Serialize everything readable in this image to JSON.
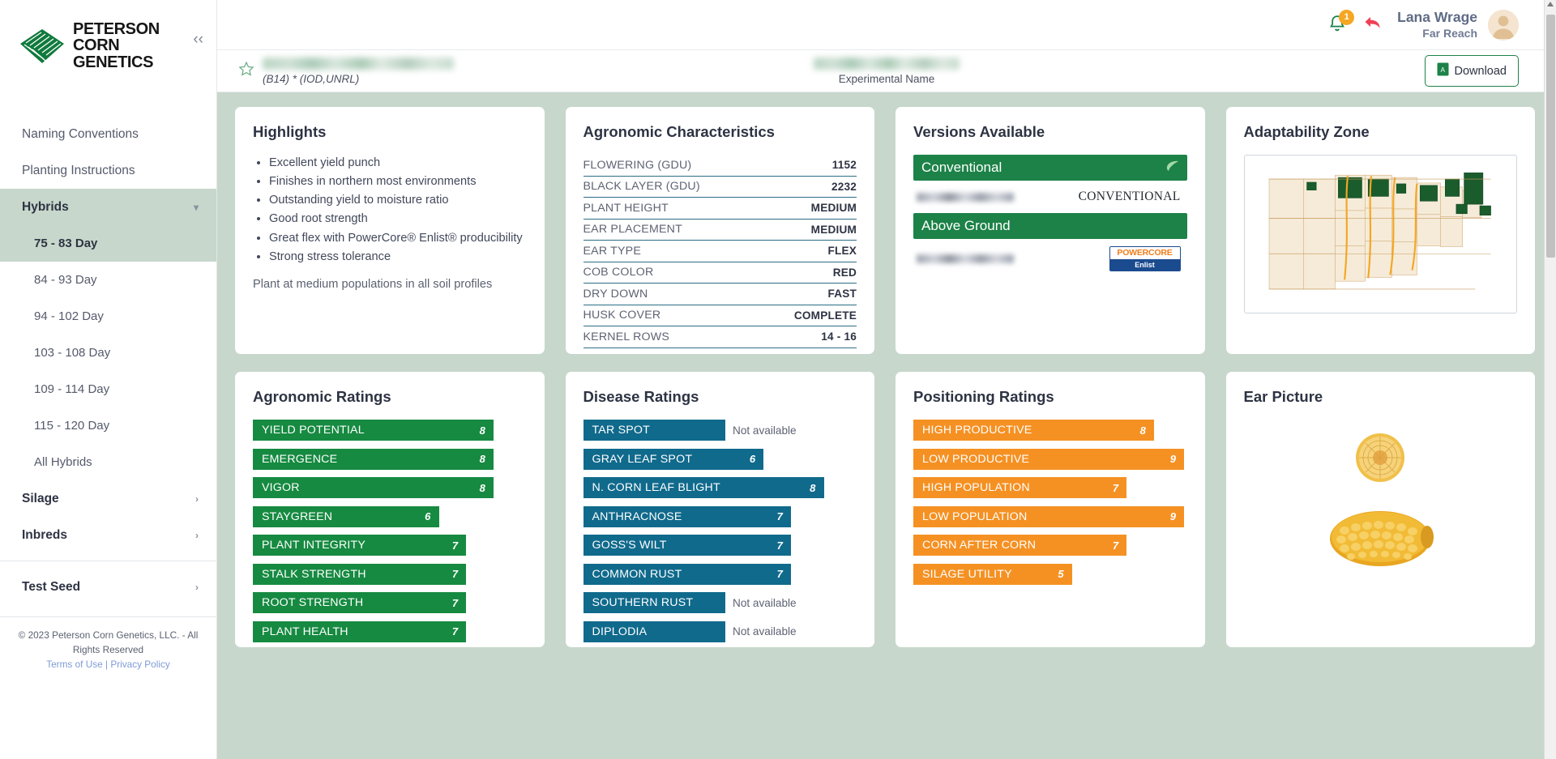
{
  "brand": {
    "line1": "PETERSON",
    "line2": "CORN GENETICS",
    "collapse_icon": "chevron-left"
  },
  "sidebar": {
    "items": [
      {
        "label": "Naming Conventions",
        "type": "link"
      },
      {
        "label": "Planting Instructions",
        "type": "link"
      },
      {
        "label": "Hybrids",
        "type": "group",
        "active": true,
        "chevron": "⌄"
      },
      {
        "label": "75 - 83 Day",
        "type": "sub",
        "active": true
      },
      {
        "label": "84 - 93 Day",
        "type": "sub"
      },
      {
        "label": "94 - 102 Day",
        "type": "sub"
      },
      {
        "label": "103 - 108 Day",
        "type": "sub"
      },
      {
        "label": "109 - 114 Day",
        "type": "sub"
      },
      {
        "label": "115 - 120 Day",
        "type": "sub"
      },
      {
        "label": "All Hybrids",
        "type": "sub"
      },
      {
        "label": "Silage",
        "type": "group",
        "chevron": "›"
      },
      {
        "label": "Inbreds",
        "type": "group",
        "chevron": "›"
      },
      {
        "label": "Test Seed",
        "type": "group",
        "chevron": "›"
      }
    ],
    "footer": {
      "copyright": "© 2023 Peterson Corn Genetics, LLC. - All Rights Reserved",
      "terms": "Terms of Use",
      "separator": "|",
      "privacy": "Privacy Policy"
    }
  },
  "topbar": {
    "notification_count": "1",
    "bell_icon": "bell-icon",
    "reply_icon": "reply-arrow-icon",
    "user_name": "Lana Wrage",
    "user_org": "Far Reach",
    "avatar": "user-avatar"
  },
  "titlebar": {
    "star_icon": "star-outline-icon",
    "product_name_redacted": true,
    "product_code": "(B14) * (IOD,UNRL)",
    "experimental_name_redacted": true,
    "experimental_label": "Experimental Name",
    "download_label": "Download",
    "download_icon": "pdf-file-icon"
  },
  "highlights": {
    "title": "Highlights",
    "bullets": [
      "Excellent yield punch",
      "Finishes in northern most environments",
      "Outstanding yield to moisture ratio",
      "Good root strength",
      "Great flex with PowerCore® Enlist® producibility",
      "Strong stress tolerance"
    ],
    "note": "Plant at medium populations in all soil profiles"
  },
  "agronomic_characteristics": {
    "title": "Agronomic Characteristics",
    "rows": [
      {
        "key": "FLOWERING (GDU)",
        "value": "1152"
      },
      {
        "key": "BLACK LAYER (GDU)",
        "value": "2232"
      },
      {
        "key": "PLANT HEIGHT",
        "value": "MEDIUM"
      },
      {
        "key": "EAR PLACEMENT",
        "value": "MEDIUM"
      },
      {
        "key": "EAR TYPE",
        "value": "FLEX"
      },
      {
        "key": "COB COLOR",
        "value": "RED"
      },
      {
        "key": "DRY DOWN",
        "value": "FAST"
      },
      {
        "key": "HUSK COVER",
        "value": "COMPLETE"
      },
      {
        "key": "KERNEL ROWS",
        "value": "14 - 16"
      }
    ]
  },
  "versions_available": {
    "title": "Versions Available",
    "groups": [
      {
        "header": "Conventional",
        "header_icon": "leaf-icon",
        "rows": [
          {
            "name_redacted": true,
            "trait_label": "CONVENTIONAL",
            "badge": "text"
          }
        ]
      },
      {
        "header": "Above Ground",
        "header_icon": "",
        "rows": [
          {
            "name_redacted": true,
            "trait_label": "",
            "badge": "powercore-enlist-logo",
            "logo_top": "POWERCORE",
            "logo_bottom": "Enlist"
          }
        ]
      }
    ]
  },
  "adaptability_zone": {
    "title": "Adaptability Zone",
    "map_icon": "us-midwest-map"
  },
  "agronomic_ratings": {
    "title": "Agronomic Ratings",
    "color": "#168a41",
    "items": [
      {
        "label": "YIELD POTENTIAL",
        "value": "8"
      },
      {
        "label": "EMERGENCE",
        "value": "8"
      },
      {
        "label": "VIGOR",
        "value": "8"
      },
      {
        "label": "STAYGREEN",
        "value": "6"
      },
      {
        "label": "PLANT INTEGRITY",
        "value": "7"
      },
      {
        "label": "STALK STRENGTH",
        "value": "7"
      },
      {
        "label": "ROOT STRENGTH",
        "value": "7"
      },
      {
        "label": "PLANT HEALTH",
        "value": "7"
      }
    ]
  },
  "disease_ratings": {
    "title": "Disease Ratings",
    "color": "#106a8c",
    "not_available_text": "Not available",
    "items": [
      {
        "label": "TAR SPOT",
        "value": null
      },
      {
        "label": "GRAY LEAF SPOT",
        "value": "6"
      },
      {
        "label": "N. CORN LEAF BLIGHT",
        "value": "8"
      },
      {
        "label": "ANTHRACNOSE",
        "value": "7"
      },
      {
        "label": "GOSS'S WILT",
        "value": "7"
      },
      {
        "label": "COMMON RUST",
        "value": "7"
      },
      {
        "label": "SOUTHERN RUST",
        "value": null
      },
      {
        "label": "DIPLODIA",
        "value": null
      }
    ]
  },
  "positioning_ratings": {
    "title": "Positioning Ratings",
    "color": "#f59123",
    "items": [
      {
        "label": "HIGH PRODUCTIVE",
        "value": "8"
      },
      {
        "label": "LOW PRODUCTIVE",
        "value": "9"
      },
      {
        "label": "HIGH POPULATION",
        "value": "7"
      },
      {
        "label": "LOW POPULATION",
        "value": "9"
      },
      {
        "label": "CORN AFTER CORN",
        "value": "7"
      },
      {
        "label": "SILAGE UTILITY",
        "value": "5"
      }
    ]
  },
  "ear_picture": {
    "title": "Ear Picture",
    "image": "corn-ear-photo"
  },
  "colors": {
    "brand_green": "#1c8247",
    "panel_bg": "#c7d7cb",
    "rating_green": "#168a41",
    "rating_blue": "#106a8c",
    "rating_orange": "#f59123",
    "spec_rule": "#2b6e86"
  }
}
